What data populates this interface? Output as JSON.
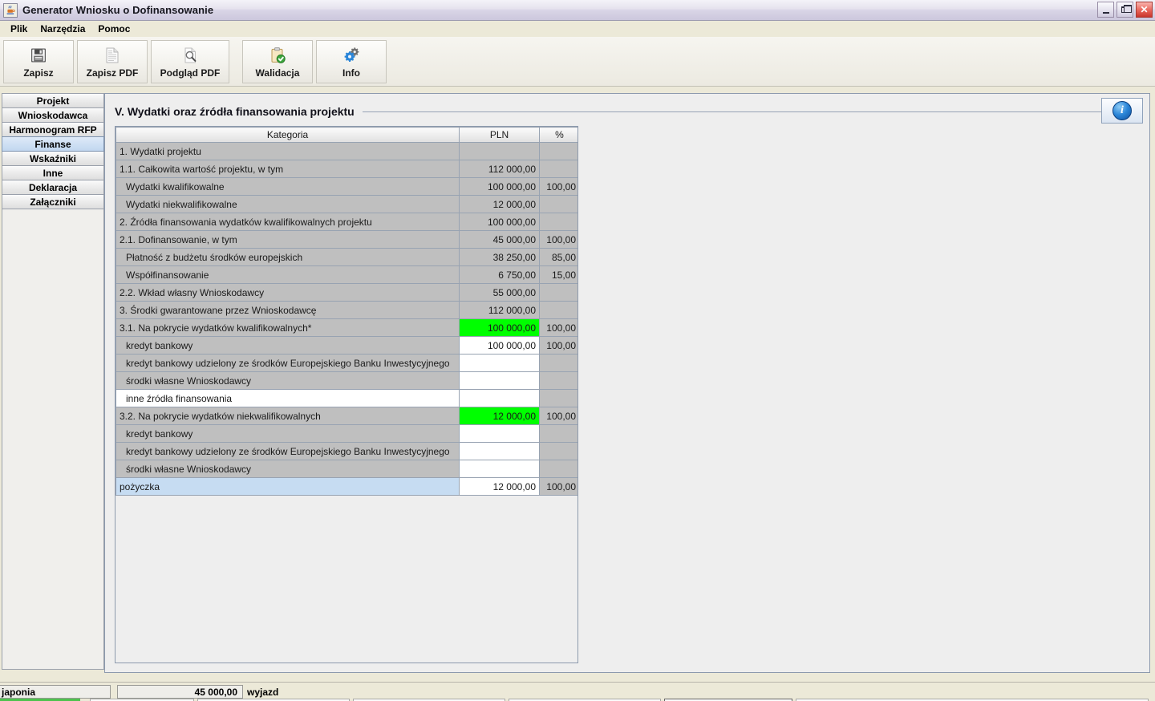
{
  "window": {
    "title": "Generator Wniosku o Dofinansowanie",
    "app_icon": "java-coffee-cup-icon",
    "controls": {
      "minimize": "minimize-icon",
      "restore": "restore-icon",
      "close": "✕"
    }
  },
  "menubar": {
    "items": [
      {
        "label": "Plik"
      },
      {
        "label": "Narzędzia"
      },
      {
        "label": "Pomoc"
      }
    ]
  },
  "toolbar": {
    "buttons": [
      {
        "label": "Zapisz",
        "icon": "floppy-disk-icon"
      },
      {
        "label": "Zapisz PDF",
        "icon": "document-save-icon"
      },
      {
        "label": "Podgląd PDF",
        "icon": "document-magnifier-icon"
      },
      {
        "label": "Walidacja",
        "icon": "clipboard-check-icon"
      },
      {
        "label": "Info",
        "icon": "gears-icon"
      }
    ]
  },
  "sidebar": {
    "items": [
      {
        "label": "Projekt",
        "active": false
      },
      {
        "label": "Wnioskodawca",
        "active": false
      },
      {
        "label": "Harmonogram RFP",
        "active": false
      },
      {
        "label": "Finanse",
        "active": true
      },
      {
        "label": "Wskaźniki",
        "active": false
      },
      {
        "label": "Inne",
        "active": false
      },
      {
        "label": "Deklaracja",
        "active": false
      },
      {
        "label": "Załączniki",
        "active": false
      }
    ]
  },
  "section": {
    "title": "V. Wydatki oraz źródła finansowania projektu",
    "info_button": "info-icon"
  },
  "table": {
    "columns": [
      "Kategoria",
      "PLN",
      "%"
    ],
    "rows": [
      {
        "category": "1. Wydatki projektu",
        "pln": "",
        "pct": "",
        "indent": false,
        "cat_editable": false,
        "pln_editable": false,
        "green": false,
        "selected": false
      },
      {
        "category": "1.1. Całkowita wartość projektu, w tym",
        "pln": "112 000,00",
        "pct": "",
        "indent": false,
        "cat_editable": false,
        "pln_editable": false,
        "green": false,
        "selected": false
      },
      {
        "category": "Wydatki kwalifikowalne",
        "pln": "100 000,00",
        "pct": "100,00",
        "indent": true,
        "cat_editable": false,
        "pln_editable": false,
        "green": false,
        "selected": false
      },
      {
        "category": "Wydatki niekwalifikowalne",
        "pln": "12 000,00",
        "pct": "",
        "indent": true,
        "cat_editable": false,
        "pln_editable": false,
        "green": false,
        "selected": false
      },
      {
        "category": "2. Źródła finansowania wydatków kwalifikowalnych projektu",
        "pln": "100 000,00",
        "pct": "",
        "indent": false,
        "cat_editable": false,
        "pln_editable": false,
        "green": false,
        "selected": false
      },
      {
        "category": "2.1. Dofinansowanie, w tym",
        "pln": "45 000,00",
        "pct": "100,00",
        "indent": false,
        "cat_editable": false,
        "pln_editable": false,
        "green": false,
        "selected": false
      },
      {
        "category": "Płatność z budżetu środków europejskich",
        "pln": "38 250,00",
        "pct": "85,00",
        "indent": true,
        "cat_editable": false,
        "pln_editable": false,
        "green": false,
        "selected": false
      },
      {
        "category": "Współfinansowanie",
        "pln": "6 750,00",
        "pct": "15,00",
        "indent": true,
        "cat_editable": false,
        "pln_editable": false,
        "green": false,
        "selected": false
      },
      {
        "category": "2.2. Wkład własny Wnioskodawcy",
        "pln": "55 000,00",
        "pct": "",
        "indent": false,
        "cat_editable": false,
        "pln_editable": false,
        "green": false,
        "selected": false
      },
      {
        "category": "3. Środki gwarantowane przez Wnioskodawcę",
        "pln": "112 000,00",
        "pct": "",
        "indent": false,
        "cat_editable": false,
        "pln_editable": false,
        "green": false,
        "selected": false
      },
      {
        "category": "3.1. Na pokrycie wydatków kwalifikowalnych*",
        "pln": "100 000,00",
        "pct": "100,00",
        "indent": false,
        "cat_editable": false,
        "pln_editable": false,
        "green": true,
        "selected": false
      },
      {
        "category": "kredyt bankowy",
        "pln": "100 000,00",
        "pct": "100,00",
        "indent": true,
        "cat_editable": false,
        "pln_editable": true,
        "green": false,
        "selected": false
      },
      {
        "category": "kredyt bankowy udzielony ze środków Europejskiego Banku Inwestycyjnego",
        "pln": "",
        "pct": "",
        "indent": true,
        "cat_editable": false,
        "pln_editable": true,
        "green": false,
        "selected": false
      },
      {
        "category": "środki własne Wnioskodawcy",
        "pln": "",
        "pct": "",
        "indent": true,
        "cat_editable": false,
        "pln_editable": true,
        "green": false,
        "selected": false
      },
      {
        "category": "inne źródła finansowania",
        "pln": "",
        "pct": "",
        "indent": true,
        "cat_editable": true,
        "pln_editable": true,
        "green": false,
        "selected": false
      },
      {
        "category": "3.2. Na pokrycie wydatków niekwalifikowalnych",
        "pln": "12 000,00",
        "pct": "100,00",
        "indent": false,
        "cat_editable": false,
        "pln_editable": false,
        "green": true,
        "selected": false
      },
      {
        "category": "kredyt bankowy",
        "pln": "",
        "pct": "",
        "indent": true,
        "cat_editable": false,
        "pln_editable": true,
        "green": false,
        "selected": false
      },
      {
        "category": "kredyt bankowy udzielony ze środków Europejskiego Banku Inwestycyjnego",
        "pln": "",
        "pct": "",
        "indent": true,
        "cat_editable": false,
        "pln_editable": true,
        "green": false,
        "selected": false
      },
      {
        "category": "środki własne Wnioskodawcy",
        "pln": "",
        "pct": "",
        "indent": true,
        "cat_editable": false,
        "pln_editable": true,
        "green": false,
        "selected": false
      },
      {
        "category": "pożyczka",
        "pln": "12 000,00",
        "pct": "100,00",
        "indent": false,
        "cat_editable": false,
        "pln_editable": true,
        "green": false,
        "selected": true
      }
    ]
  },
  "bottom_strip": {
    "field1": "japonia",
    "field2": "45 000,00",
    "field3": "wyjazd"
  },
  "colors": {
    "highlight_green": "#00ff00",
    "selection_blue": "#c6dcf2",
    "cell_gray": "#bfbfbf",
    "accent_blue": "#2b86d8"
  }
}
